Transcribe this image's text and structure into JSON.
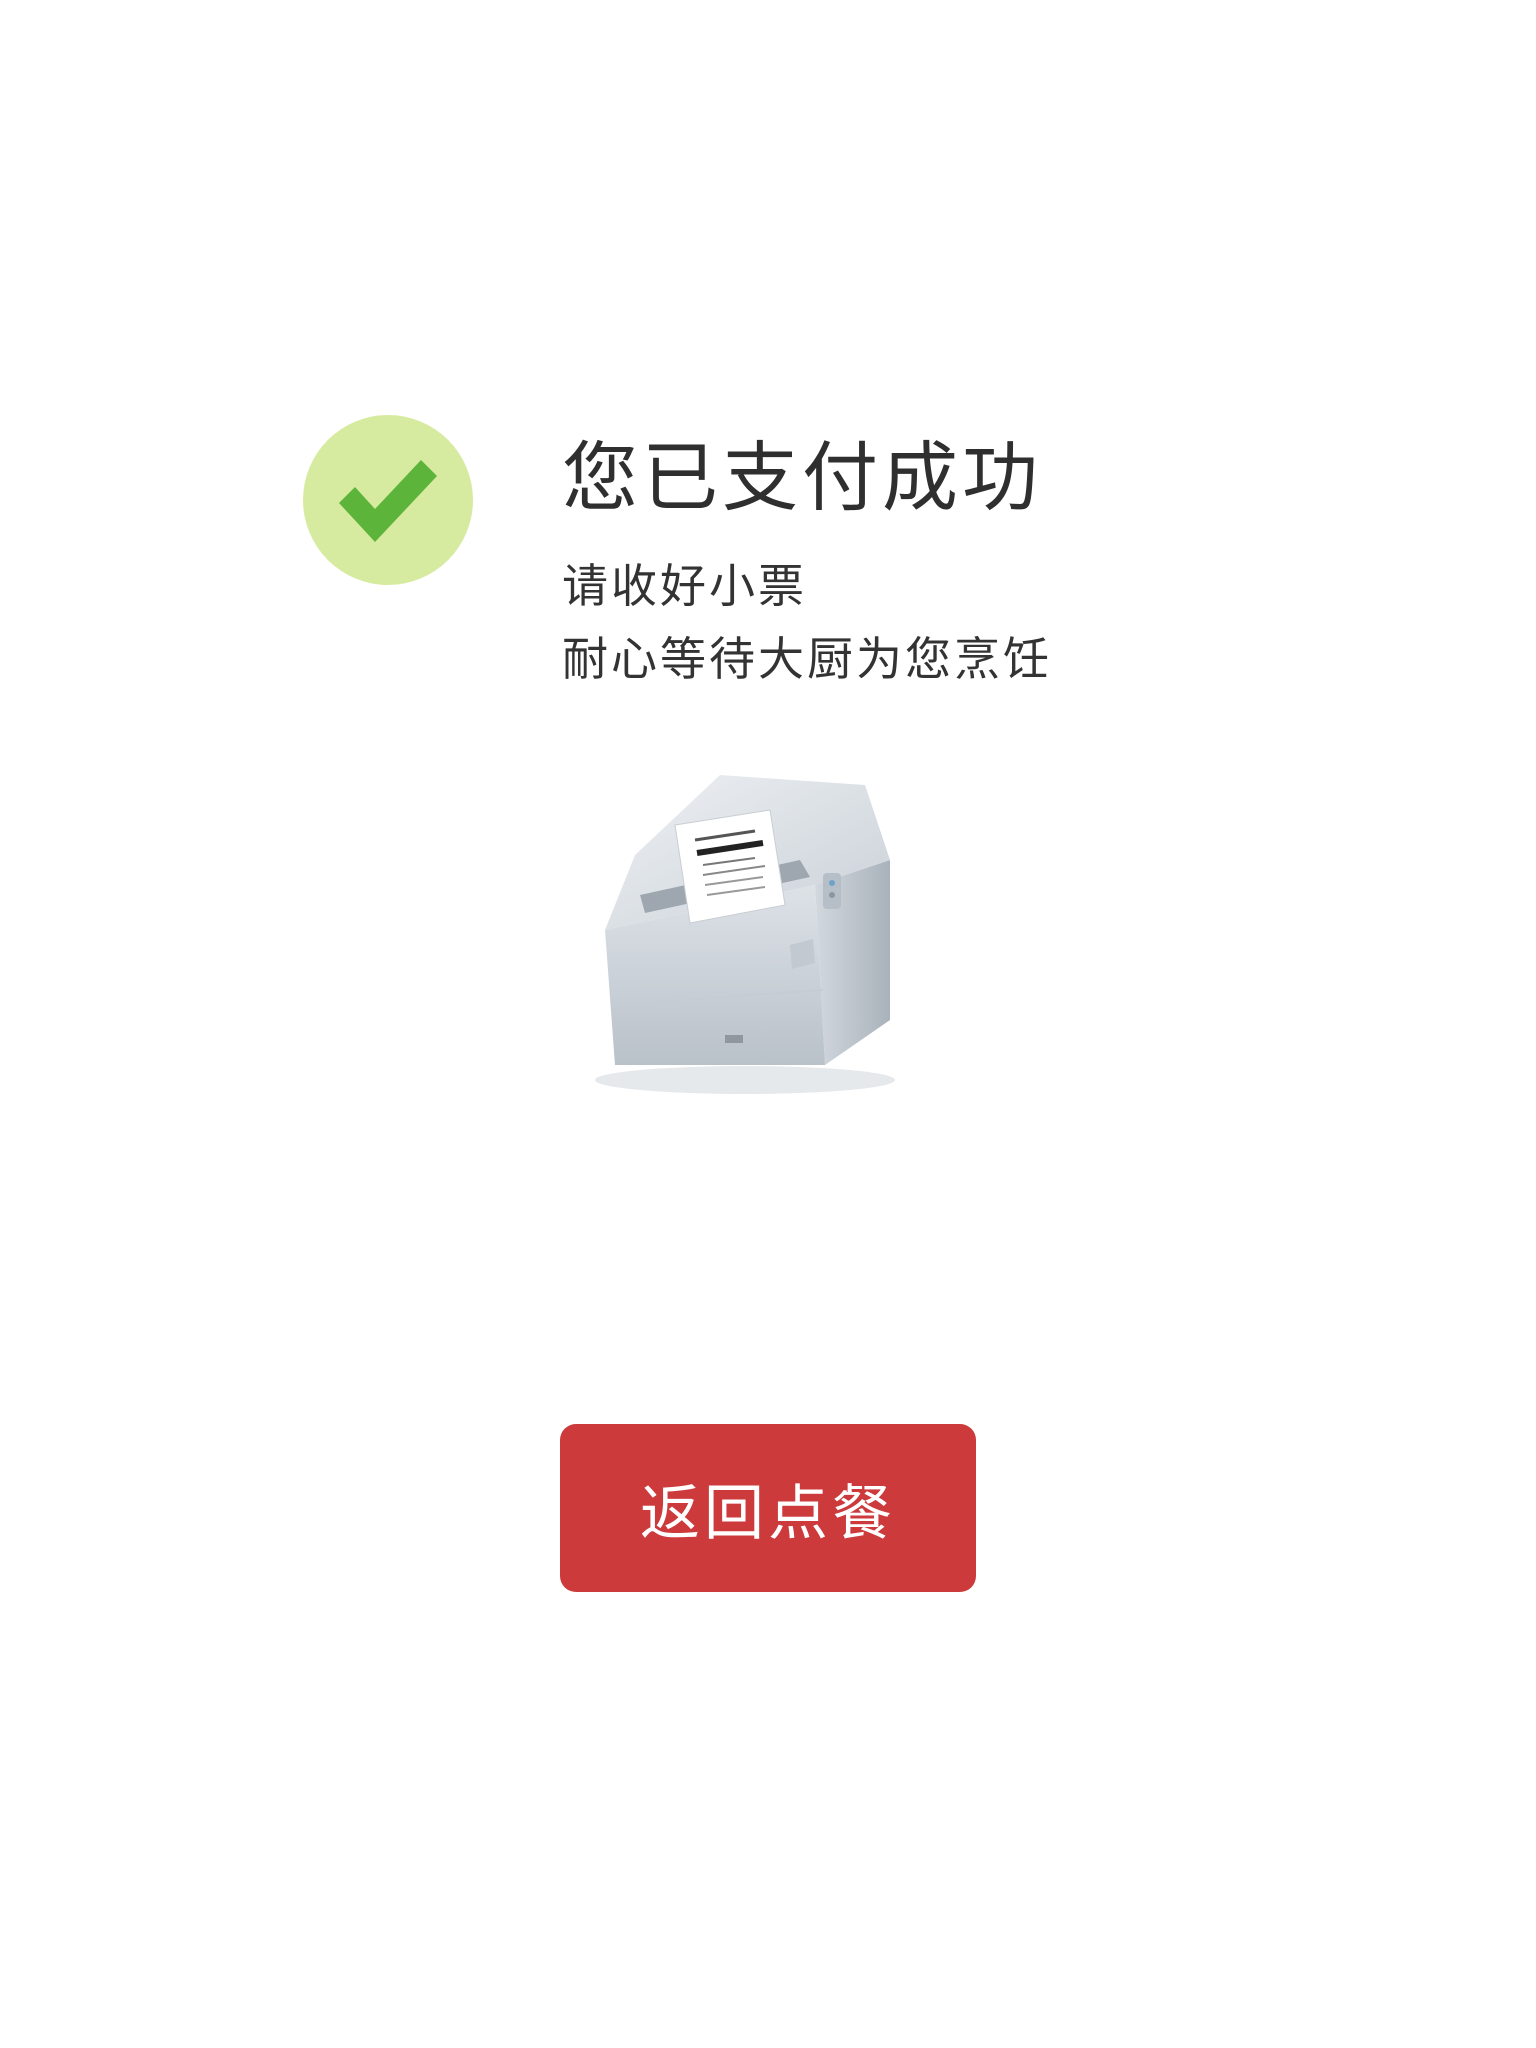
{
  "status": {
    "icon": "check-circle-icon",
    "title": "您已支付成功",
    "lines": [
      "请收好小票",
      "耐心等待大厨为您烹饪"
    ]
  },
  "illustration": {
    "icon": "receipt-printer-illustration"
  },
  "actions": {
    "return_label": "返回点餐"
  },
  "colors": {
    "check_circle_bg": "#d7eba0",
    "check_mark": "#5db43a",
    "button_bg": "#cc3a3b",
    "button_text": "#ffffff",
    "title_text": "#2f2f2f"
  }
}
